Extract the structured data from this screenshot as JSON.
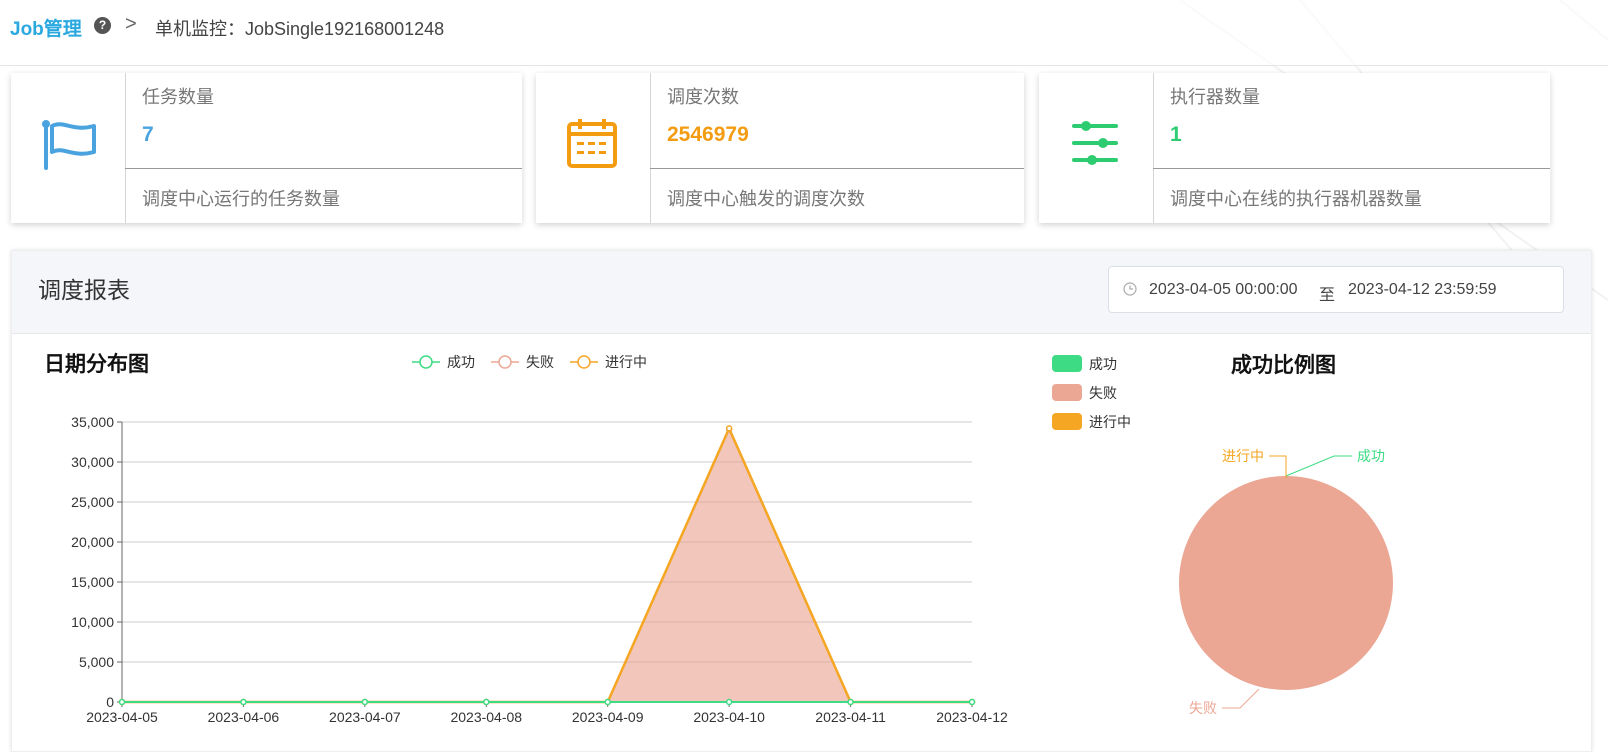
{
  "header": {
    "brand": "Job管理",
    "help_icon": "question-circle-icon",
    "separator": ">",
    "current": "单机监控：JobSingle192168001248"
  },
  "cards": [
    {
      "label": "任务数量",
      "value": "7",
      "desc": "调度中心运行的任务数量",
      "icon": "flag-icon",
      "color": "#4aa3df"
    },
    {
      "label": "调度次数",
      "value": "2546979",
      "desc": "调度中心触发的调度次数",
      "icon": "calendar-icon",
      "color": "#f39c12"
    },
    {
      "label": "执行器数量",
      "value": "1",
      "desc": "调度中心在线的执行器机器数量",
      "icon": "sliders-icon",
      "color": "#2ecc71"
    }
  ],
  "report": {
    "title": "调度报表",
    "date_start": "2023-04-05 00:00:00",
    "date_sep": "至",
    "date_end": "2023-04-12 23:59:59"
  },
  "colors": {
    "success": "#3ddc84",
    "fail": "#eba794",
    "running": "#f5a623"
  },
  "chart_data": [
    {
      "type": "line",
      "title": "日期分布图",
      "x": [
        "2023-04-05",
        "2023-04-06",
        "2023-04-07",
        "2023-04-08",
        "2023-04-09",
        "2023-04-10",
        "2023-04-11",
        "2023-04-12"
      ],
      "ylim": [
        0,
        35000
      ],
      "yticks": [
        "0",
        "5,000",
        "10,000",
        "15,000",
        "20,000",
        "25,000",
        "30,000",
        "35,000"
      ],
      "legend": [
        "成功",
        "失败",
        "进行中"
      ],
      "legend_position": "top-center",
      "series": [
        {
          "name": "成功",
          "values": [
            0,
            0,
            0,
            0,
            0,
            0,
            0,
            0
          ]
        },
        {
          "name": "失败",
          "values": [
            0,
            0,
            0,
            0,
            0,
            34100,
            0,
            0
          ]
        },
        {
          "name": "进行中",
          "values": [
            0,
            0,
            0,
            0,
            0,
            34200,
            0,
            0
          ]
        }
      ]
    },
    {
      "type": "pie",
      "title": "成功比例图",
      "legend_position": "left",
      "slices": [
        {
          "name": "成功",
          "value": 0
        },
        {
          "name": "失败",
          "value": 100
        },
        {
          "name": "进行中",
          "value": 0
        }
      ]
    }
  ]
}
